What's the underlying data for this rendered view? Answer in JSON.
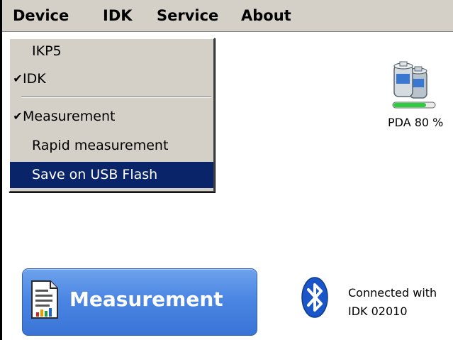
{
  "menubar": {
    "items": [
      {
        "label": "Device"
      },
      {
        "label": "IDK"
      },
      {
        "label": "Service"
      },
      {
        "label": "About"
      }
    ]
  },
  "device_menu": {
    "items": [
      {
        "label": "IKP5",
        "checked": false
      },
      {
        "label": "IDK",
        "checked": true
      },
      {
        "label": "Measurement",
        "checked": true
      },
      {
        "label": "Rapid measurement",
        "checked": false
      },
      {
        "label": "Save on USB Flash",
        "checked": false,
        "highlighted": true
      }
    ],
    "check_glyph": "✔"
  },
  "battery": {
    "icon": "battery-icon",
    "label": "PDA 80 %",
    "level": 0.8,
    "bar_color": "#2ecc40"
  },
  "measurement_button": {
    "label": "Measurement",
    "icon": "document-chart-icon",
    "color": "#4b86e3"
  },
  "bluetooth": {
    "icon": "bluetooth-icon",
    "status_line1": "Connected with",
    "status_line2": "IDK 02010",
    "color": "#1a56c8"
  }
}
